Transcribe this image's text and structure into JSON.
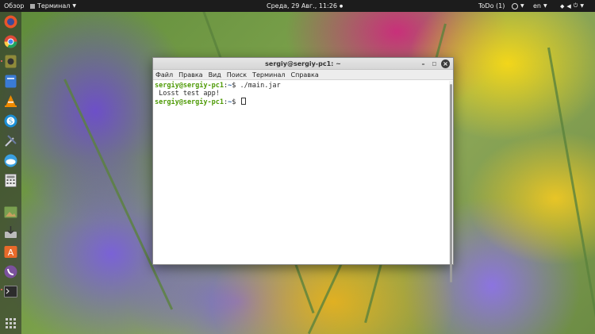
{
  "topbar": {
    "activities": "Обзор",
    "app_menu": "Терминал",
    "clock": "Среда, 29 Авг., 11:26",
    "todo": "ToDo (1)",
    "language": "en"
  },
  "dock": {
    "items": [
      {
        "name": "firefox-icon",
        "color": "#e8552b"
      },
      {
        "name": "chrome-icon",
        "color": "#dd4b39"
      },
      {
        "name": "media-player-icon",
        "color": "#8f8a3a"
      },
      {
        "name": "files-icon",
        "color": "#3a7bd5"
      },
      {
        "name": "vlc-icon",
        "color": "#f08a00"
      },
      {
        "name": "skype-icon",
        "color": "#1c8fd6"
      },
      {
        "name": "tools-icon",
        "color": "#6a7aa0"
      },
      {
        "name": "weather-icon",
        "color": "#3aa0e0"
      },
      {
        "name": "calculator-icon",
        "color": "#8a8a8a"
      },
      {
        "name": "image-viewer-icon",
        "color": "#7aa050"
      },
      {
        "name": "installer-icon",
        "color": "#9a9a9a"
      },
      {
        "name": "software-center-icon",
        "color": "#e86a2a"
      },
      {
        "name": "viber-icon",
        "color": "#7b519d"
      },
      {
        "name": "terminal-icon",
        "color": "#2c2c2c"
      },
      {
        "name": "app-grid-icon",
        "color": "#cccccc"
      }
    ]
  },
  "window": {
    "title": "sergiy@sergiy-pc1: ~",
    "menu": [
      "Файл",
      "Правка",
      "Вид",
      "Поиск",
      "Терминал",
      "Справка"
    ]
  },
  "terminal": {
    "prompt_user": "sergiy@sergiy-pc1",
    "prompt_path": "~",
    "lines": [
      {
        "command": " ./main.jar"
      },
      {
        "output": " Losst test app!"
      },
      {
        "command": ""
      }
    ]
  }
}
